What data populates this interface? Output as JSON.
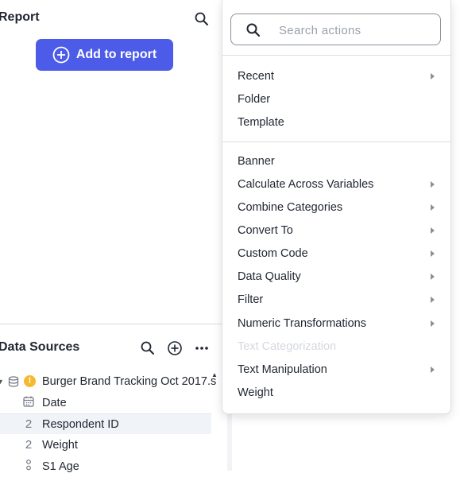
{
  "report": {
    "title": "Report",
    "add_button_label": "Add to report"
  },
  "data_sources": {
    "title": "Data Sources",
    "items": [
      {
        "label": "Burger Brand Tracking Oct 2017.s",
        "icon": "database-icon",
        "status": "warning-icon"
      },
      {
        "label": "Date",
        "icon": "calendar-icon"
      },
      {
        "label": "Respondent ID",
        "icon": "numeric-icon",
        "type_glyph": "2"
      },
      {
        "label": "Weight",
        "icon": "numeric-icon",
        "type_glyph": "2"
      },
      {
        "label": "S1 Age",
        "icon": "ordinal-icon"
      }
    ]
  },
  "menu": {
    "search_placeholder": "Search actions",
    "group1": [
      {
        "label": "Recent",
        "submenu": true
      },
      {
        "label": "Folder",
        "submenu": false
      },
      {
        "label": "Template",
        "submenu": false
      }
    ],
    "group2": [
      {
        "label": "Banner",
        "submenu": false
      },
      {
        "label": "Calculate Across Variables",
        "submenu": true
      },
      {
        "label": "Combine Categories",
        "submenu": true
      },
      {
        "label": "Convert To",
        "submenu": true
      },
      {
        "label": "Custom Code",
        "submenu": true
      },
      {
        "label": "Data Quality",
        "submenu": true
      },
      {
        "label": "Filter",
        "submenu": true
      },
      {
        "label": "Numeric Transformations",
        "submenu": true
      },
      {
        "label": "Text Categorization",
        "submenu": false,
        "disabled": true
      },
      {
        "label": "Text Manipulation",
        "submenu": true
      },
      {
        "label": "Weight",
        "submenu": false
      }
    ]
  },
  "colors": {
    "accent": "#4d5ce8",
    "warning": "#f5b82e"
  }
}
